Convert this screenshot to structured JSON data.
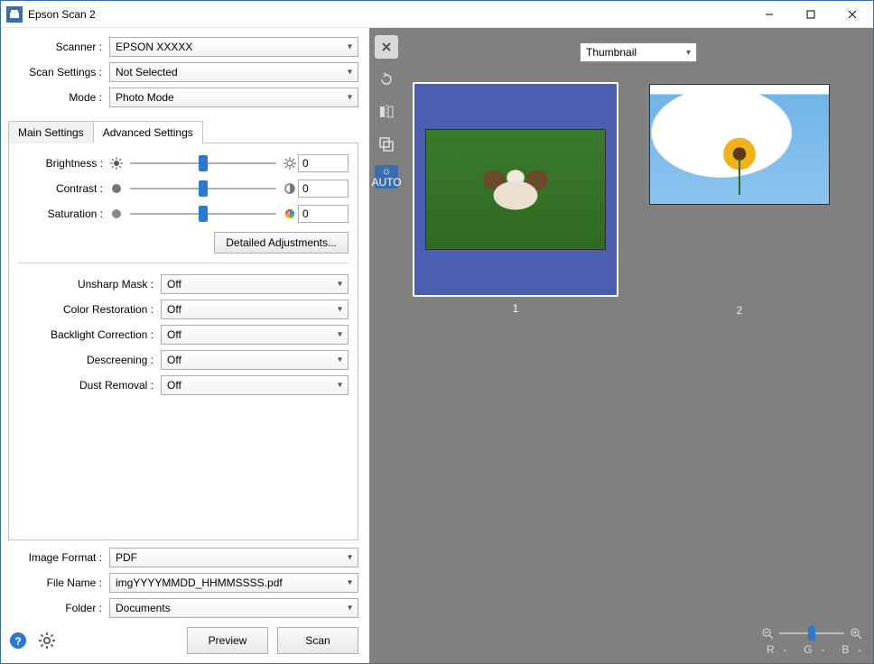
{
  "window": {
    "title": "Epson Scan 2"
  },
  "top": {
    "scanner_label": "Scanner :",
    "scanner_value": "EPSON XXXXX",
    "scan_settings_label": "Scan Settings :",
    "scan_settings_value": "Not Selected",
    "mode_label": "Mode :",
    "mode_value": "Photo Mode"
  },
  "tabs": {
    "main": "Main Settings",
    "advanced": "Advanced Settings"
  },
  "adjust": {
    "brightness_label": "Brightness :",
    "brightness_value": "0",
    "contrast_label": "Contrast :",
    "contrast_value": "0",
    "saturation_label": "Saturation :",
    "saturation_value": "0",
    "detailed_btn": "Detailed Adjustments..."
  },
  "options": {
    "unsharp_label": "Unsharp Mask :",
    "unsharp_value": "Off",
    "color_restore_label": "Color Restoration :",
    "color_restore_value": "Off",
    "backlight_label": "Backlight Correction :",
    "backlight_value": "Off",
    "descreening_label": "Descreening :",
    "descreening_value": "Off",
    "dust_label": "Dust Removal :",
    "dust_value": "Off"
  },
  "output": {
    "format_label": "Image Format :",
    "format_value": "PDF",
    "filename_label": "File Name :",
    "filename_value": "imgYYYYMMDD_HHMMSSSS.pdf",
    "folder_label": "Folder :",
    "folder_value": "Documents"
  },
  "actions": {
    "preview": "Preview",
    "scan": "Scan"
  },
  "preview": {
    "view_mode": "Thumbnail",
    "auto_label": "AUTO",
    "thumbs": [
      {
        "num": "1"
      },
      {
        "num": "2"
      }
    ],
    "rgb": {
      "r": "R",
      "g": "G",
      "b": "B",
      "dash": "-"
    }
  }
}
